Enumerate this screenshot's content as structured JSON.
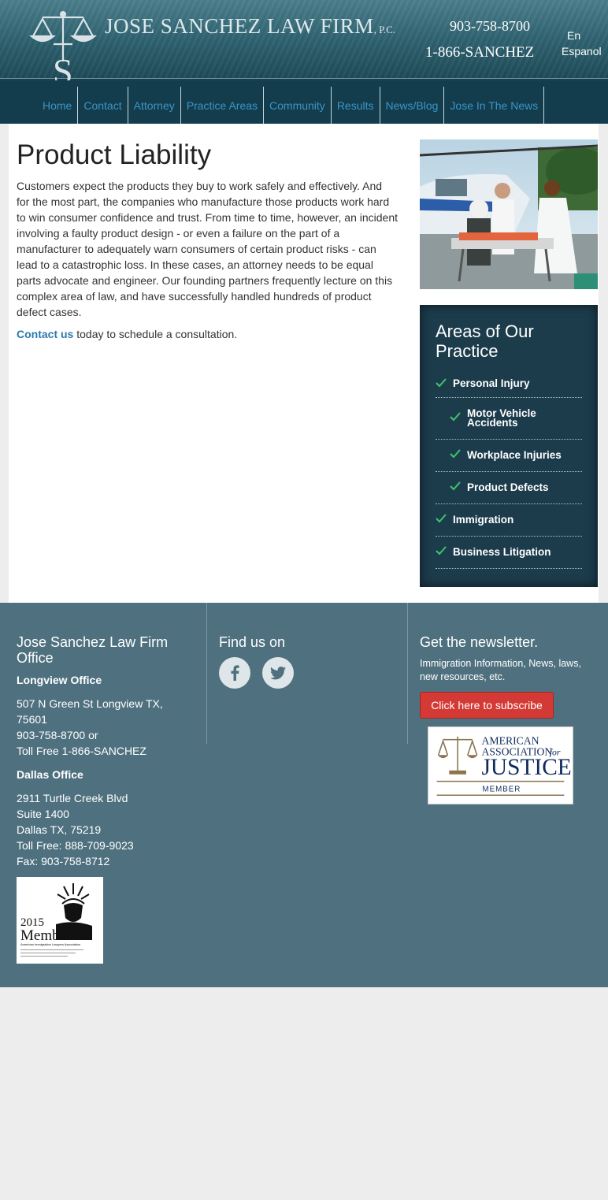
{
  "header": {
    "firm_name": "JOSE SANCHEZ LAW FIRM",
    "firm_suffix": "P.C.",
    "logo_letter": "S",
    "phone_primary": "903-758-8700",
    "phone_toll_free": "1-866-SANCHEZ",
    "lang_en": "En",
    "lang_es": "Espanol"
  },
  "nav": {
    "items": [
      "Home",
      "Contact",
      "Attorney",
      "Practice Areas",
      "Community",
      "Results",
      "News/Blog",
      "Jose In The News"
    ]
  },
  "main": {
    "title": "Product Liability",
    "body": "Customers expect the products they buy to work safely and effectively. And for the most part, the companies who manufacture those products work hard to win consumer confidence and trust. From time to time, however, an incident involving a faulty product design - or even a failure on the part of a manufacturer to adequately warn consumers of certain product risks - can lead to a catastrophic loss. In these cases, an attorney needs to be equal parts advocate and engineer. Our founding partners frequently lecture on this complex area of law, and have successfully handled hundreds of product defect cases.",
    "contact_link": "Contact us",
    "contact_rest": " today to schedule a consultation."
  },
  "sidebar": {
    "areas_title": "Areas of Our Practice",
    "items": [
      "Personal Injury",
      "Motor Vehicle Accidents",
      "Workplace Injuries",
      "Product Defects",
      "Immigration",
      "Business Litigation"
    ],
    "check_color": "#3ec46d"
  },
  "footer": {
    "office_heading": "Jose Sanchez Law Firm Office",
    "longview_label": "Longview Office",
    "longview_address": "507 N Green St Longview TX, 75601",
    "longview_phone": "903-758-8700 or",
    "longview_tollfree": "Toll Free 1-866-SANCHEZ",
    "dallas_label": "Dallas Office",
    "dallas_street": "2911 Turtle Creek Blvd",
    "dallas_suite": "Suite 1400",
    "dallas_city": "Dallas TX, 75219",
    "dallas_tollfree": "Toll Free: 888-709-9023",
    "dallas_fax": "Fax: 903-758-8712",
    "find_us": "Find us on",
    "newsletter_heading": "Get the newsletter.",
    "newsletter_text": "Immigration Information, News, laws, new resources, etc.",
    "subscribe_label": "Click here to subscribe",
    "aaj_line1": "AMERICAN",
    "aaj_line2": "ASSOCIATION",
    "aaj_for": "for",
    "aaj_line3": "JUSTICE",
    "aaj_member": "MEMBER",
    "aila_year": "2015",
    "aila_member": "Member",
    "aila_org": "American Immigration Lawyers Association"
  },
  "colors": {
    "nav_link": "#3d95c7",
    "footer_bg": "#4f717f",
    "subscribe_bg": "#d33a35",
    "areas_bg": "#1c3c4c"
  }
}
